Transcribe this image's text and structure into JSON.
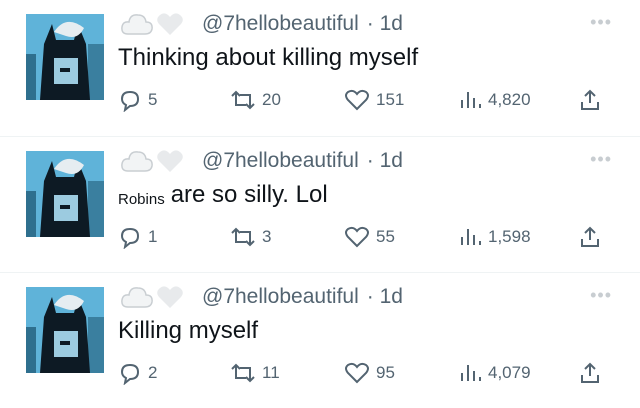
{
  "tweets": [
    {
      "handle": "@7hellobeautiful",
      "time": "· 1d",
      "prefix": "",
      "text": "Thinking about killing myself",
      "replies": "5",
      "retweets": "20",
      "likes": "151",
      "views": "4,820"
    },
    {
      "handle": "@7hellobeautiful",
      "time": "· 1d",
      "prefix": "Robins",
      "text": "are so silly. Lol",
      "replies": "1",
      "retweets": "3",
      "likes": "55",
      "views": "1,598"
    },
    {
      "handle": "@7hellobeautiful",
      "time": "· 1d",
      "prefix": "",
      "text": "Killing myself",
      "replies": "2",
      "retweets": "11",
      "likes": "95",
      "views": "4,079"
    }
  ],
  "icons": {
    "more": "more-dots-icon",
    "reply": "reply-icon",
    "retweet": "retweet-icon",
    "like": "heart-icon",
    "views": "views-icon",
    "share": "share-icon",
    "badges": [
      "cloud-icon",
      "heart-icon"
    ]
  },
  "colors": {
    "text": "#0f1419",
    "muted": "#536471",
    "avatar_bg": "#5fb3d9"
  }
}
